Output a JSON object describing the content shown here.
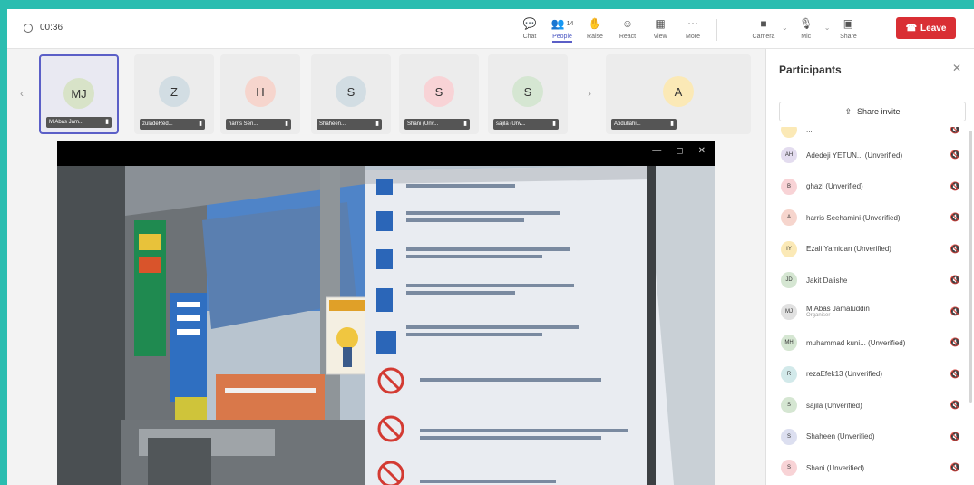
{
  "header": {
    "timer": "00:36",
    "toolbar": [
      {
        "name": "chat",
        "label": "Chat",
        "icon": "chat-icon"
      },
      {
        "name": "people",
        "label": "People",
        "count": "14",
        "icon": "people-icon"
      },
      {
        "name": "raise",
        "label": "Raise",
        "icon": "hand-icon"
      },
      {
        "name": "react",
        "label": "React",
        "icon": "smile-icon"
      },
      {
        "name": "view",
        "label": "View",
        "icon": "grid-icon"
      },
      {
        "name": "more",
        "label": "More",
        "icon": "more-icon"
      }
    ],
    "camera_label": "Camera",
    "mic_label": "Mic",
    "share_label": "Share",
    "leave_label": "Leave"
  },
  "gallery": [
    {
      "initials": "MJ",
      "name": "M Abas Jam...",
      "color": "#d8e3c8"
    },
    {
      "initials": "Z",
      "name": "zuladeRed...",
      "color": "#d2dde3"
    },
    {
      "initials": "H",
      "name": "harris Sen...",
      "color": "#f6d5cd"
    },
    {
      "initials": "S",
      "name": "Shaheen...",
      "color": "#d2dde3"
    },
    {
      "initials": "S",
      "name": "Shani (Unv...",
      "color": "#f8d3d6"
    },
    {
      "initials": "S",
      "name": "sajila (Unv...",
      "color": "#d5e6d2"
    },
    {
      "initials": "A",
      "name": "Abdullahi...",
      "color": "#fbe9b6"
    }
  ],
  "shared_screen": {
    "controls": [
      "—",
      "◻",
      "✕"
    ]
  },
  "panel": {
    "title": "Participants",
    "invite_label": "Share invite",
    "participants": [
      {
        "initials": "",
        "name": "...",
        "sub": "",
        "color": "#fbe9b6"
      },
      {
        "initials": "AH",
        "name": "Adedeji YETUN... (Unverified)",
        "sub": "",
        "color": "#e3dcef"
      },
      {
        "initials": "B",
        "name": "ghazi (Unverified)",
        "sub": "",
        "color": "#f8d3d6"
      },
      {
        "initials": "A",
        "name": "harris Seehamini (Unverified)",
        "sub": "",
        "color": "#f6d5cd"
      },
      {
        "initials": "IY",
        "name": "Ezali Yamidan (Unverified)",
        "sub": "",
        "color": "#fbe9b6"
      },
      {
        "initials": "JD",
        "name": "Jakit Dalishe",
        "sub": "",
        "color": "#d5e6d2"
      },
      {
        "initials": "MJ",
        "name": "M Abas Jamaluddin",
        "sub": "Organiser",
        "color": "#e1e1e1"
      },
      {
        "initials": "MH",
        "name": "muhammad kuni... (Unverified)",
        "sub": "",
        "color": "#d5e6d2"
      },
      {
        "initials": "R",
        "name": "rezaEfek13 (Unverified)",
        "sub": "",
        "color": "#d2e9ea"
      },
      {
        "initials": "S",
        "name": "sajila (Unverified)",
        "sub": "",
        "color": "#d5e6d2"
      },
      {
        "initials": "S",
        "name": "Shaheen (Unverified)",
        "sub": "",
        "color": "#dcdff0"
      },
      {
        "initials": "S",
        "name": "Shani (Unverified)",
        "sub": "",
        "color": "#f8d3d6"
      }
    ]
  },
  "colors": {
    "accent": "#5b5fc7",
    "leave": "#d92f34",
    "frame": "#2bbdb0"
  }
}
